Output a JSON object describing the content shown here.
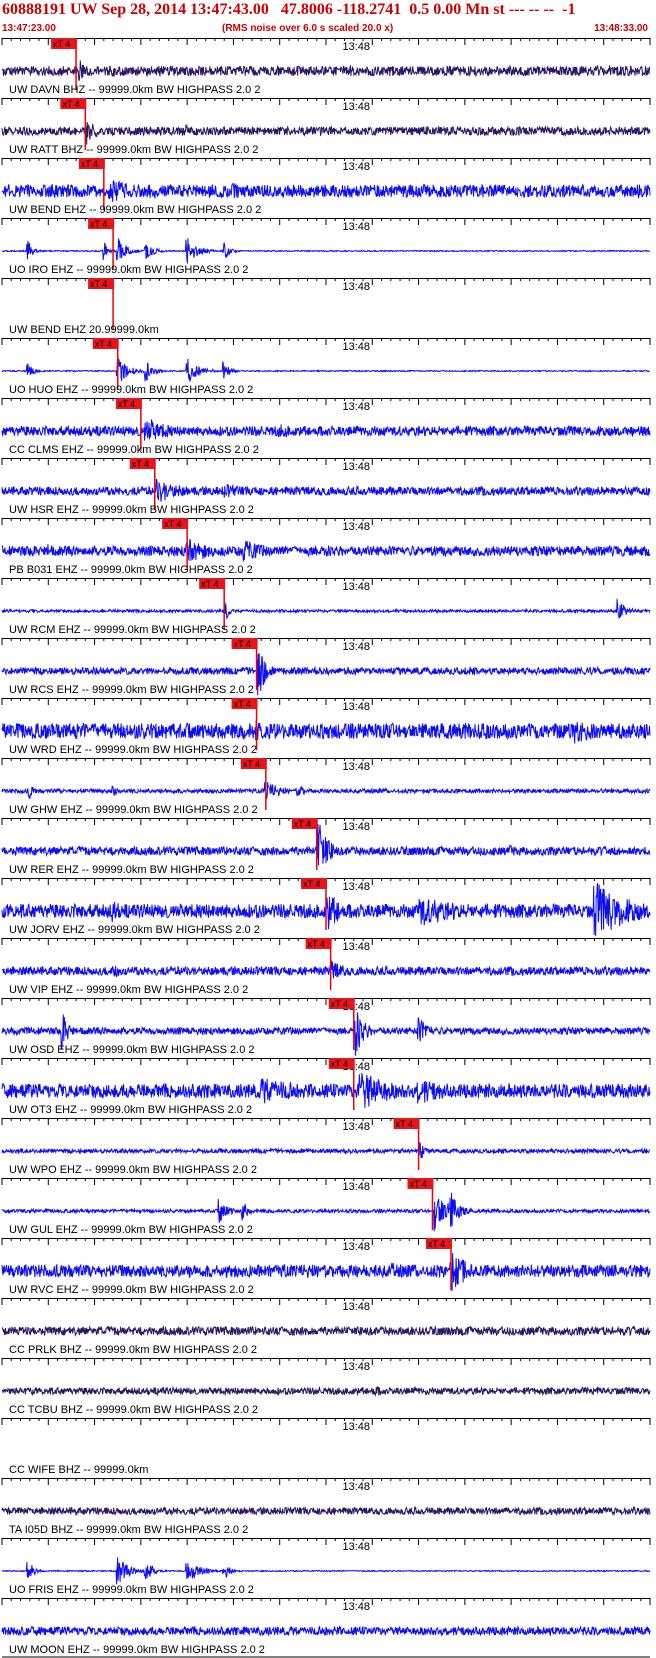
{
  "header": {
    "title": "60888191 UW Sep 28, 2014 13:47:43.00   47.8006 -118.2741  0.5 0.00 Mn st --- -- --  -1",
    "start_time": "13:47:23.00",
    "note": "(RMS noise over 6.0 s scaled 20.0 x)",
    "end_time": "13:48:33.00"
  },
  "chart_data": {
    "type": "line",
    "title": "60888191 UW Sep 28, 2014 13:47:43.00   47.8006 -118.2741  0.5 0.00 Mn st --- -- --  -1",
    "xlabel": "",
    "ylabel": "",
    "x_start": "13:47:23.00",
    "x_end": "13:48:33.00",
    "xlim_seconds": [
      0,
      70
    ],
    "tick_label": "13:48",
    "pick_label": "xT 4",
    "colors": {
      "pick": "#e8141a",
      "pick_line": "#ee0000",
      "header": "#cc0000",
      "axis": "#000000",
      "trace_blue": "#0d0df5",
      "trace_dark": "#2a1866"
    },
    "traces": [
      {
        "label": "UW DAVN BHZ -- 99999.0km BW  HIGHPASS  2.0  2",
        "pick_s": 8.0,
        "color": "dark",
        "amp": 0.35,
        "bursts": [
          [
            8.3,
            1.0,
            0.9
          ],
          [
            12,
            3,
            0.4
          ],
          [
            30,
            4,
            0.3
          ],
          [
            45,
            3,
            0.3
          ]
        ]
      },
      {
        "label": "UW RATT BHZ -- 99999.0km BW  HIGHPASS  2.0  2",
        "pick_s": 9.0,
        "color": "dark",
        "amp": 0.3,
        "bursts": [
          [
            9.3,
            1.0,
            1.0
          ],
          [
            20,
            3,
            0.4
          ],
          [
            35,
            2,
            0.4
          ],
          [
            50,
            3,
            0.3
          ]
        ]
      },
      {
        "label": "UW BEND EHZ -- 99999.0km BW  HIGHPASS  2.0  2",
        "pick_s": 11.0,
        "color": "blue",
        "amp": 0.45,
        "bursts": [
          [
            11.5,
            4,
            0.9
          ],
          [
            16,
            4,
            0.6
          ],
          [
            25,
            3,
            0.6
          ],
          [
            40,
            3,
            0.5
          ]
        ]
      },
      {
        "label": "UO IRO EHZ -- 99999.0km BW  HIGHPASS  2.0  2",
        "pick_s": 12.0,
        "color": "blue",
        "amp": 0.04,
        "bursts": [
          [
            2.8,
            0.6,
            0.8
          ],
          [
            11,
            0.5,
            0.7
          ],
          [
            12.5,
            1,
            1.0
          ],
          [
            15.5,
            0.8,
            0.8
          ],
          [
            20,
            1.2,
            1.0
          ],
          [
            24,
            0.6,
            0.7
          ]
        ]
      },
      {
        "label": "UW BEND EHZ 20.99999.0km",
        "pick_s": 12.0,
        "color": "none",
        "amp": 0,
        "bursts": []
      },
      {
        "label": "UO HUO EHZ -- 99999.0km BW  HIGHPASS  2.0  2",
        "pick_s": 12.5,
        "color": "blue",
        "amp": 0.04,
        "bursts": [
          [
            2.8,
            0.5,
            0.8
          ],
          [
            12.5,
            1.2,
            1.0
          ],
          [
            15.5,
            0.8,
            0.8
          ],
          [
            20,
            1.2,
            1.0
          ],
          [
            24,
            0.6,
            0.7
          ]
        ]
      },
      {
        "label": "CC CLMS EHZ -- 99999.0km BW  HIGHPASS  2.0  2",
        "pick_s": 15.0,
        "color": "blue",
        "amp": 0.35,
        "bursts": [
          [
            15.5,
            3,
            1.0
          ],
          [
            30,
            4,
            0.5
          ],
          [
            45,
            3,
            0.4
          ]
        ]
      },
      {
        "label": "UW HSR EHZ -- 99999.0km BW  HIGHPASS  2.0  2",
        "pick_s": 16.5,
        "color": "blue",
        "amp": 0.3,
        "bursts": [
          [
            16.8,
            3,
            0.9
          ],
          [
            24,
            4,
            0.5
          ]
        ]
      },
      {
        "label": "PB B031 EHZ -- 99999.0km BW  HIGHPASS  2.0  2",
        "pick_s": 20.0,
        "color": "blue",
        "amp": 0.35,
        "bursts": [
          [
            20,
            3,
            1.0
          ],
          [
            26,
            3,
            0.9
          ],
          [
            5,
            1,
            0.6
          ],
          [
            35,
            3,
            0.4
          ]
        ]
      },
      {
        "label": "UW RCM EHZ -- 99999.0km BW  HIGHPASS  2.0  2",
        "pick_s": 24.0,
        "color": "blue",
        "amp": 0.1,
        "bursts": [
          [
            24.2,
            0.4,
            0.7
          ],
          [
            66.5,
            1,
            0.9
          ]
        ]
      },
      {
        "label": "UW RCS EHZ -- 99999.0km BW  HIGHPASS  2.0  2",
        "pick_s": 27.5,
        "color": "blue",
        "amp": 0.25,
        "bursts": [
          [
            27.7,
            0.8,
            2.0
          ]
        ]
      },
      {
        "label": "UW WRD EHZ -- 99999.0km BW  HIGHPASS  2.0  2",
        "pick_s": 27.5,
        "color": "blue",
        "amp": 0.55,
        "bursts": [
          [
            27.5,
            1,
            1.0
          ],
          [
            50,
            5,
            0.6
          ],
          [
            62,
            4,
            0.9
          ]
        ]
      },
      {
        "label": "UW GHW EHZ -- 99999.0km BW  HIGHPASS  2.0  2",
        "pick_s": 28.5,
        "color": "blue",
        "amp": 0.15,
        "bursts": [
          [
            3,
            0.5,
            0.6
          ],
          [
            12,
            0.5,
            0.5
          ],
          [
            28.5,
            1.5,
            0.8
          ],
          [
            32,
            1,
            0.5
          ]
        ]
      },
      {
        "label": "UW RER EHZ -- 99999.0km BW  HIGHPASS  2.0  2",
        "pick_s": 34.0,
        "color": "blue",
        "amp": 0.3,
        "bursts": [
          [
            34.2,
            1.0,
            2.5
          ],
          [
            55,
            3,
            0.4
          ]
        ]
      },
      {
        "label": "UW JORV EHZ -- 99999.0km BW  HIGHPASS  2.0  2",
        "pick_s": 35.0,
        "color": "blue",
        "amp": 0.5,
        "bursts": [
          [
            12,
            1,
            1.0
          ],
          [
            35.2,
            2,
            1.4
          ],
          [
            45,
            6,
            1.2
          ],
          [
            64,
            4,
            2.2
          ]
        ]
      },
      {
        "label": "UW VIP EHZ -- 99999.0km BW  HIGHPASS  2.0  2",
        "pick_s": 35.5,
        "color": "blue",
        "amp": 0.3,
        "bursts": [
          [
            12,
            1.5,
            0.6
          ],
          [
            35.5,
            2,
            0.8
          ]
        ]
      },
      {
        "label": "UW OSD EHZ -- 99999.0km BW  HIGHPASS  2.0  2",
        "pick_s": 38.0,
        "color": "blue",
        "amp": 0.25,
        "bursts": [
          [
            6.5,
            0.8,
            1.4
          ],
          [
            38.2,
            1,
            1.8
          ],
          [
            45,
            1.5,
            1.0
          ]
        ]
      },
      {
        "label": "UW OT3 EHZ -- 99999.0km BW  HIGHPASS  2.0  2",
        "pick_s": 38.0,
        "color": "blue",
        "amp": 0.5,
        "bursts": [
          [
            28,
            6,
            1.0
          ],
          [
            38.5,
            4,
            1.6
          ],
          [
            45,
            4,
            1.0
          ]
        ]
      },
      {
        "label": "UW WPO EHZ -- 99999.0km BW  HIGHPASS  2.0  2",
        "pick_s": 45.0,
        "color": "blue",
        "amp": 0.15,
        "bursts": [
          [
            45.2,
            0.4,
            0.8
          ]
        ]
      },
      {
        "label": "UW GUL EHZ -- 99999.0km BW  HIGHPASS  2.0  2",
        "pick_s": 46.5,
        "color": "blue",
        "amp": 0.12,
        "bursts": [
          [
            23.5,
            1,
            0.9
          ],
          [
            26,
            0.6,
            0.8
          ],
          [
            46.8,
            1.5,
            1.6
          ],
          [
            48.5,
            1,
            1.4
          ]
        ]
      },
      {
        "label": "UW RVC EHZ -- 99999.0km BW  HIGHPASS  2.0  2",
        "pick_s": 48.5,
        "color": "blue",
        "amp": 0.45,
        "bursts": [
          [
            48.5,
            2,
            1.6
          ],
          [
            42,
            5,
            0.6
          ]
        ]
      },
      {
        "label": "CC PRLK BHZ -- 99999.0km BW  HIGHPASS  2.0  2",
        "pick_s": null,
        "color": "dark",
        "amp": 0.3,
        "bursts": []
      },
      {
        "label": "CC TCBU BHZ -- 99999.0km BW  HIGHPASS  2.0  2",
        "pick_s": null,
        "color": "dark",
        "amp": 0.25,
        "bursts": [
          [
            40,
            3,
            0.4
          ]
        ]
      },
      {
        "label": "CC WIFE BHZ -- 99999.0km",
        "pick_s": null,
        "color": "none",
        "amp": 0,
        "bursts": []
      },
      {
        "label": "TA I05D BHZ -- 99999.0km BW  HIGHPASS  2.0  2",
        "pick_s": null,
        "color": "dark",
        "amp": 0.25,
        "bursts": []
      },
      {
        "label": "UO FRIS EHZ -- 99999.0km BW  HIGHPASS  2.0  2",
        "pick_s": null,
        "color": "blue",
        "amp": 0.04,
        "bursts": [
          [
            2.8,
            0.6,
            0.9
          ],
          [
            12.5,
            1.2,
            1.0
          ],
          [
            15.5,
            0.8,
            0.9
          ],
          [
            20,
            1.2,
            1.0
          ],
          [
            24,
            0.6,
            0.7
          ]
        ]
      },
      {
        "label": "UW MOON EHZ -- 99999.0km BW  HIGHPASS  2.0  2",
        "pick_s": null,
        "color": "blue",
        "amp": 0.3,
        "bursts": []
      }
    ]
  }
}
